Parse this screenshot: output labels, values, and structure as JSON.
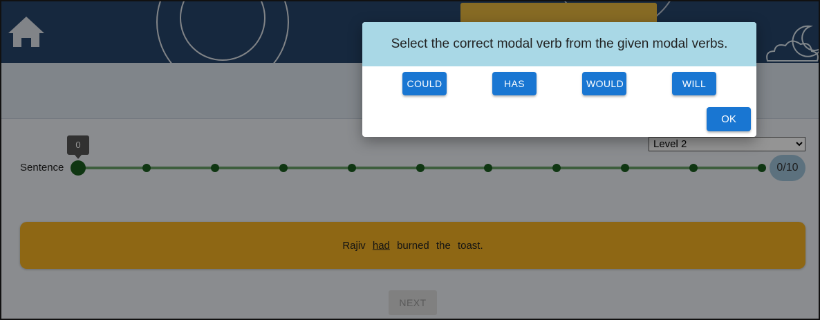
{
  "header": {
    "home_icon": "home-icon",
    "colors": {
      "background": "#26456c",
      "accent_tab": "#e9b83f"
    }
  },
  "progress": {
    "label": "Sentence",
    "tooltip_value": "0",
    "counter": "0/10",
    "current": 0,
    "total": 10
  },
  "level_select": {
    "selected": "Level 2",
    "options": [
      "Level 2"
    ]
  },
  "sentence": {
    "before": "Rajiv",
    "underlined": "had",
    "after": "burned the toast."
  },
  "next_label": "NEXT",
  "dialog": {
    "title": "Select the correct modal verb from the given modal verbs.",
    "options": [
      "COULD",
      "HAS",
      "WOULD",
      "WILL"
    ],
    "ok_label": "OK"
  }
}
